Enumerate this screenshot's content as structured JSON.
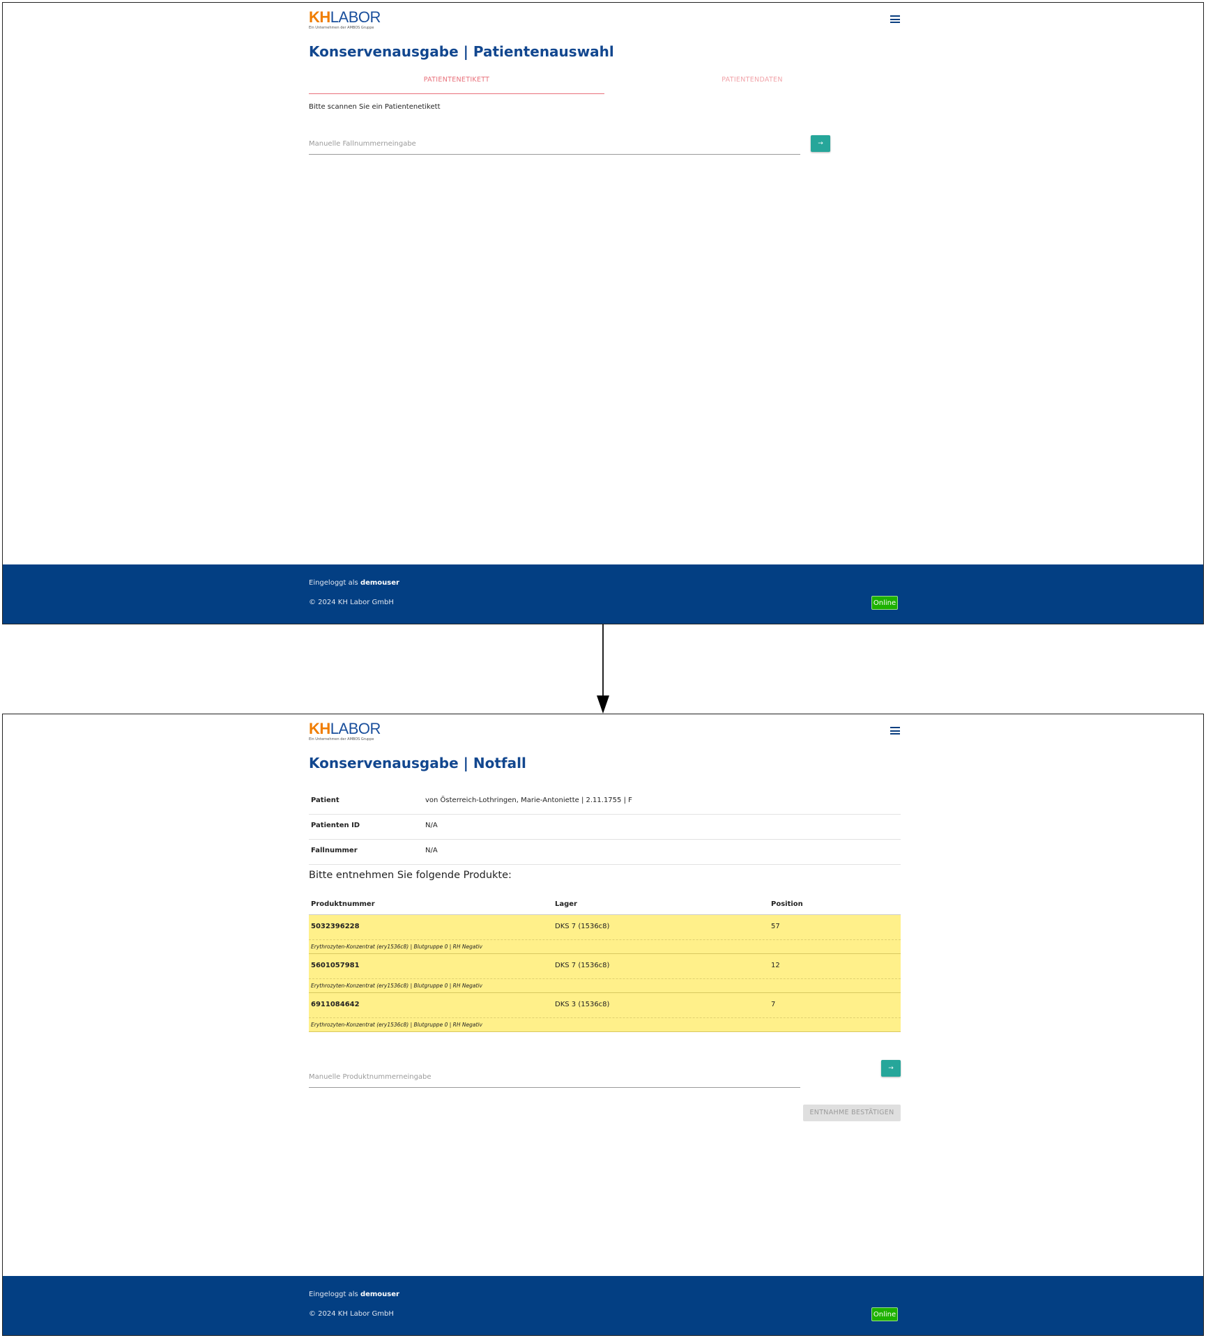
{
  "brand": {
    "logo_kh": "KH",
    "logo_labor": "LABOR",
    "logo_sub": "Ein Unternehmen der AMBOS Gruppe",
    "accent_orange": "#f07d00",
    "accent_blue": "#12478f",
    "footer_blue": "#033f83",
    "teal": "#26a69a",
    "highlight_yellow": "#fff08a"
  },
  "screen1": {
    "title": "Konservenausgabe | Patientenauswahl",
    "tabs": [
      {
        "label": "PATIENTENETIKETT",
        "active": true
      },
      {
        "label": "PATIENTENDATEN",
        "active": false
      }
    ],
    "hint": "Bitte scannen Sie ein Patientenetikett",
    "case_input_placeholder": "Manuelle Fallnummerneingabe",
    "submit_icon": "→"
  },
  "screen2": {
    "title": "Konservenausgabe | Notfall",
    "info": [
      {
        "label": "Patient",
        "value": "von Österreich-Lothringen, Marie-Antoniette | 2.11.1755 | F"
      },
      {
        "label": "Patienten ID",
        "value": "N/A"
      },
      {
        "label": "Fallnummer",
        "value": "N/A"
      }
    ],
    "products_heading": "Bitte entnehmen Sie folgende Produkte:",
    "columns": [
      "Produktnummer",
      "Lager",
      "Position"
    ],
    "products": [
      {
        "number": "5032396228",
        "storage": "DKS 7 (1536c8)",
        "position": "57",
        "description": "Erythrozyten-Konzentrat (ery1536c8) | Blutgruppe 0 | RH Negativ"
      },
      {
        "number": "5601057981",
        "storage": "DKS 7 (1536c8)",
        "position": "12",
        "description": "Erythrozyten-Konzentrat (ery1536c8) | Blutgruppe 0 | RH Negativ"
      },
      {
        "number": "6911084642",
        "storage": "DKS 3 (1536c8)",
        "position": "7",
        "description": "Erythrozyten-Konzentrat (ery1536c8) | Blutgruppe 0 | RH Negativ"
      }
    ],
    "product_input_placeholder": "Manuelle Produktnummerneingabe",
    "submit_icon": "→",
    "confirm_label": "ENTNAHME BESTÄTIGEN"
  },
  "footer": {
    "logged_prefix": "Eingeloggt als",
    "user": "demouser",
    "copyright": "© 2024 KH Labor GmbH",
    "status": "Online",
    "status_color": "#1db100"
  },
  "icons": [
    "menu-icon",
    "arrow-right-icon"
  ]
}
